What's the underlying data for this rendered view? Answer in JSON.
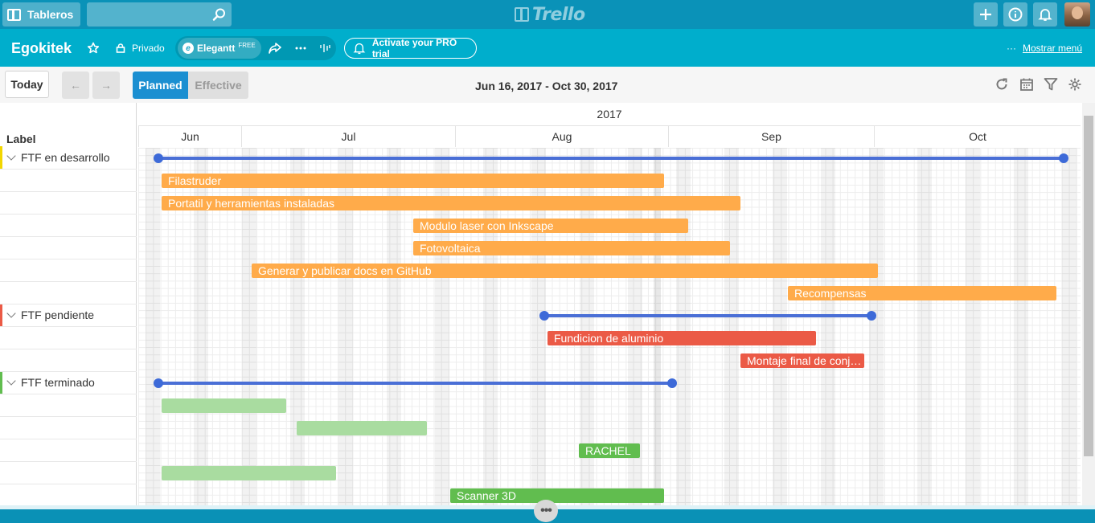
{
  "header": {
    "boards_label": "Tableros",
    "search": {
      "value": "",
      "placeholder": ""
    },
    "logo_text": "Trello",
    "icons": [
      "add-icon",
      "info-icon",
      "bell-icon"
    ]
  },
  "board": {
    "title": "Egokitek",
    "privacy": "Privado",
    "powerup_name": "Elegantt",
    "powerup_badge": "FREE",
    "pro_trial": "Activate your PRO trial",
    "menu_label": "Mostrar menú",
    "menu_dots": "···"
  },
  "toolbar": {
    "today": "Today",
    "prev": "←",
    "next": "→",
    "planned": "Planned",
    "effective": "Effective",
    "date_range": "Jun 16, 2017 - Oct 30, 2017",
    "icons": [
      "refresh-icon",
      "calendar-icon",
      "filter-icon",
      "settings-icon"
    ]
  },
  "timeline": {
    "year": "2017",
    "months": [
      "Jun",
      "Jul",
      "Aug",
      "Sep",
      "Oct"
    ],
    "label_header": "Label"
  },
  "groups": [
    {
      "label": "FTF en desarrollo",
      "color": "#f2d600",
      "bar_color": "#ffab4a",
      "tasks": [
        "Filastruder",
        "Portatil y herramientas instaladas",
        "Modulo laser con Inkscape",
        "Fotovoltaica",
        "Generar y publicar docs en GitHub",
        "Recompensas"
      ]
    },
    {
      "label": "FTF pendiente",
      "color": "#eb5a46",
      "bar_color": "#eb5a46",
      "tasks": [
        "Fundicion de aluminio",
        "Montaje final de conj…"
      ]
    },
    {
      "label": "FTF terminado",
      "color": "#61bd4f",
      "bar_color": "#61bd4f",
      "tasks": [
        "",
        "",
        "RACHEL",
        "",
        "Scanner 3D"
      ]
    }
  ],
  "colors": {
    "header_bg": "#0a92b8",
    "board_bar": "#00aecc",
    "primary": "#1b8fd1",
    "summary": "#4a6fd6"
  }
}
